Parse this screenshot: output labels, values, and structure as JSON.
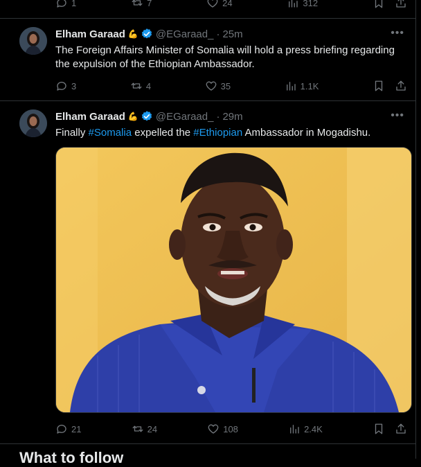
{
  "top_partial": {
    "actions": {
      "replies": "1",
      "reposts": "7",
      "likes": "24",
      "views": "312"
    }
  },
  "tweets": [
    {
      "author_name": "Elham Garaad",
      "flag_emoji": "🖏",
      "handle": "@EGaraad_",
      "separator": "·",
      "time": "25m",
      "text": "The Foreign Affairs Minister of Somalia will hold a press briefing regarding the expulsion of the Ethiopian Ambassador.",
      "actions": {
        "replies": "3",
        "reposts": "4",
        "likes": "35",
        "views": "1.1K"
      }
    },
    {
      "author_name": "Elham Garaad",
      "flag_emoji": "🖏",
      "handle": "@EGaraad_",
      "separator": "·",
      "time": "29m",
      "text_parts": [
        "Finally ",
        "#Somalia",
        " expelled the ",
        "#Ethiopian",
        " Ambassador in Mogadishu."
      ],
      "actions": {
        "replies": "21",
        "reposts": "24",
        "likes": "108",
        "views": "2.4K"
      }
    }
  ],
  "section_heading": "What to follow",
  "colors": {
    "background": "#000000",
    "text": "#e7e9ea",
    "muted": "#71767b",
    "link": "#1d9bf0",
    "verified": "#1d9bf0",
    "border": "#2f3336"
  }
}
